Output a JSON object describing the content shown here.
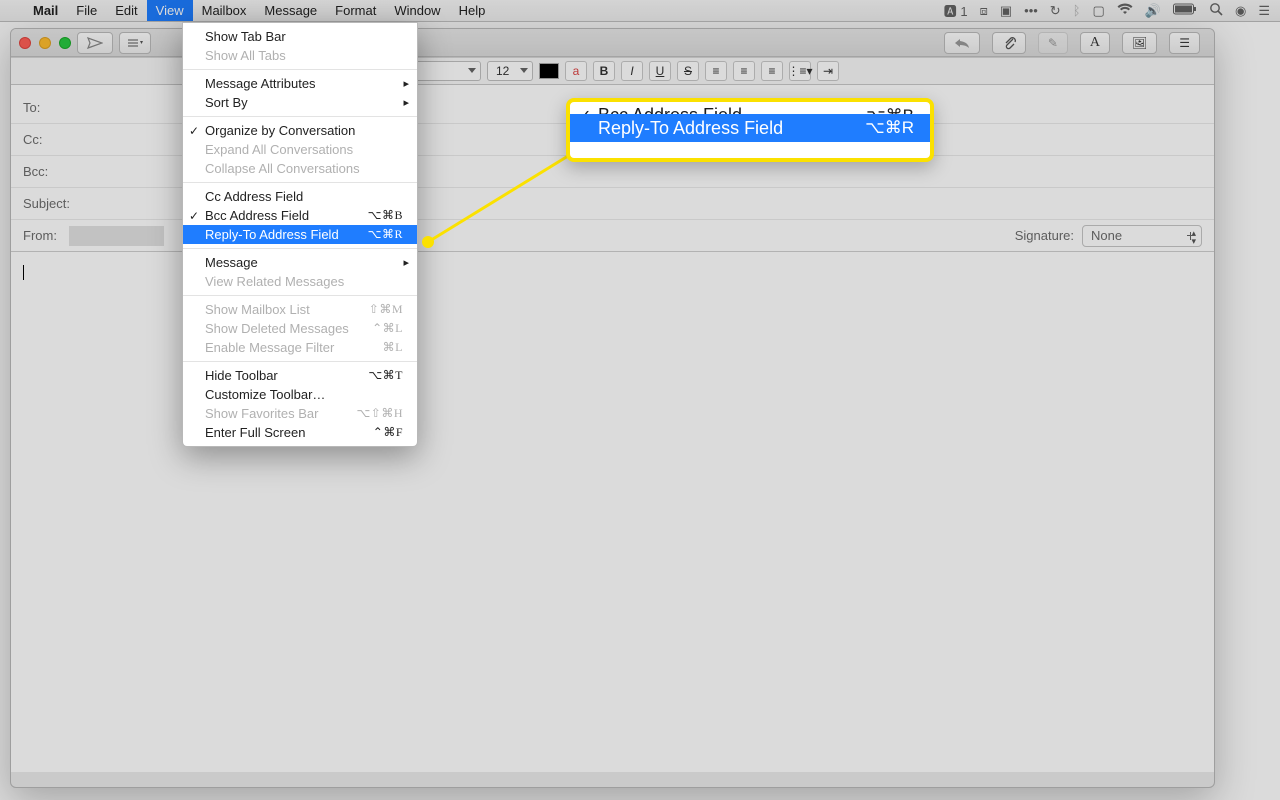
{
  "menubar": {
    "app": "Mail",
    "items": [
      "File",
      "Edit",
      "View",
      "Mailbox",
      "Message",
      "Format",
      "Window",
      "Help"
    ],
    "active": "View",
    "status": {
      "adobe_label": "1"
    }
  },
  "view_menu": {
    "show_tab_bar": "Show Tab Bar",
    "show_all_tabs": "Show All Tabs",
    "message_attributes": "Message Attributes",
    "sort_by": "Sort By",
    "organize_by_conversation": "Organize by Conversation",
    "expand_all": "Expand All Conversations",
    "collapse_all": "Collapse All Conversations",
    "cc_field": "Cc Address Field",
    "bcc_field": "Bcc Address Field",
    "bcc_shortcut": "⌥⌘B",
    "reply_to_field": "Reply-To Address Field",
    "reply_to_shortcut": "⌥⌘R",
    "message": "Message",
    "view_related": "View Related Messages",
    "show_mailbox": "Show Mailbox List",
    "show_mailbox_sc": "⇧⌘M",
    "show_deleted": "Show Deleted Messages",
    "show_deleted_sc": "⌃⌘L",
    "enable_filter": "Enable Message Filter",
    "enable_filter_sc": "⌘L",
    "hide_toolbar": "Hide Toolbar",
    "hide_toolbar_sc": "⌥⌘T",
    "customize_toolbar": "Customize Toolbar…",
    "show_favorites": "Show Favorites Bar",
    "show_favorites_sc": "⌥⇧⌘H",
    "enter_full_screen": "Enter Full Screen",
    "enter_full_screen_sc": "⌃⌘F"
  },
  "callout": {
    "bcc_field": "Bcc Address Field",
    "bcc_sc": "⌥⌘B",
    "reply_to_field": "Reply-To Address Field",
    "reply_to_sc": "⌥⌘R"
  },
  "format": {
    "font": "tica",
    "size": "12",
    "bold": "B",
    "italic": "I",
    "underline": "U",
    "strike": "S"
  },
  "headers": {
    "to": "To:",
    "cc": "Cc:",
    "bcc": "Bcc:",
    "subject": "Subject:",
    "from": "From:",
    "signature_label": "Signature:",
    "signature_value": "None"
  }
}
